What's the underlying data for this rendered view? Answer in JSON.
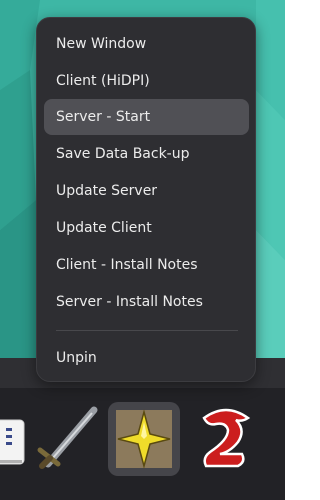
{
  "context_menu": {
    "items": [
      {
        "label": "New Window",
        "highlighted": false
      },
      {
        "label": "Client (HiDPI)",
        "highlighted": false
      },
      {
        "label": "Server - Start",
        "highlighted": true
      },
      {
        "label": "Save Data Back-up",
        "highlighted": false
      },
      {
        "label": "Update Server",
        "highlighted": false
      },
      {
        "label": "Update Client",
        "highlighted": false
      },
      {
        "label": "Client - Install Notes",
        "highlighted": false
      },
      {
        "label": "Server - Install Notes",
        "highlighted": false
      }
    ],
    "unpin_label": "Unpin"
  },
  "dock": {
    "apps": [
      {
        "icon": "notepad-app-icon",
        "active": false
      },
      {
        "icon": "sword-app-icon",
        "active": false
      },
      {
        "icon": "yellow-star-app-icon",
        "active": true
      },
      {
        "icon": "guild-wars-2-dragon-icon",
        "active": false
      }
    ]
  },
  "colors": {
    "wallpaper": "#3eb7a5",
    "menu_background": "#2e2e32",
    "menu_highlight": "#505055",
    "menu_text": "#ececec",
    "dock_background": "#2f2f33"
  }
}
